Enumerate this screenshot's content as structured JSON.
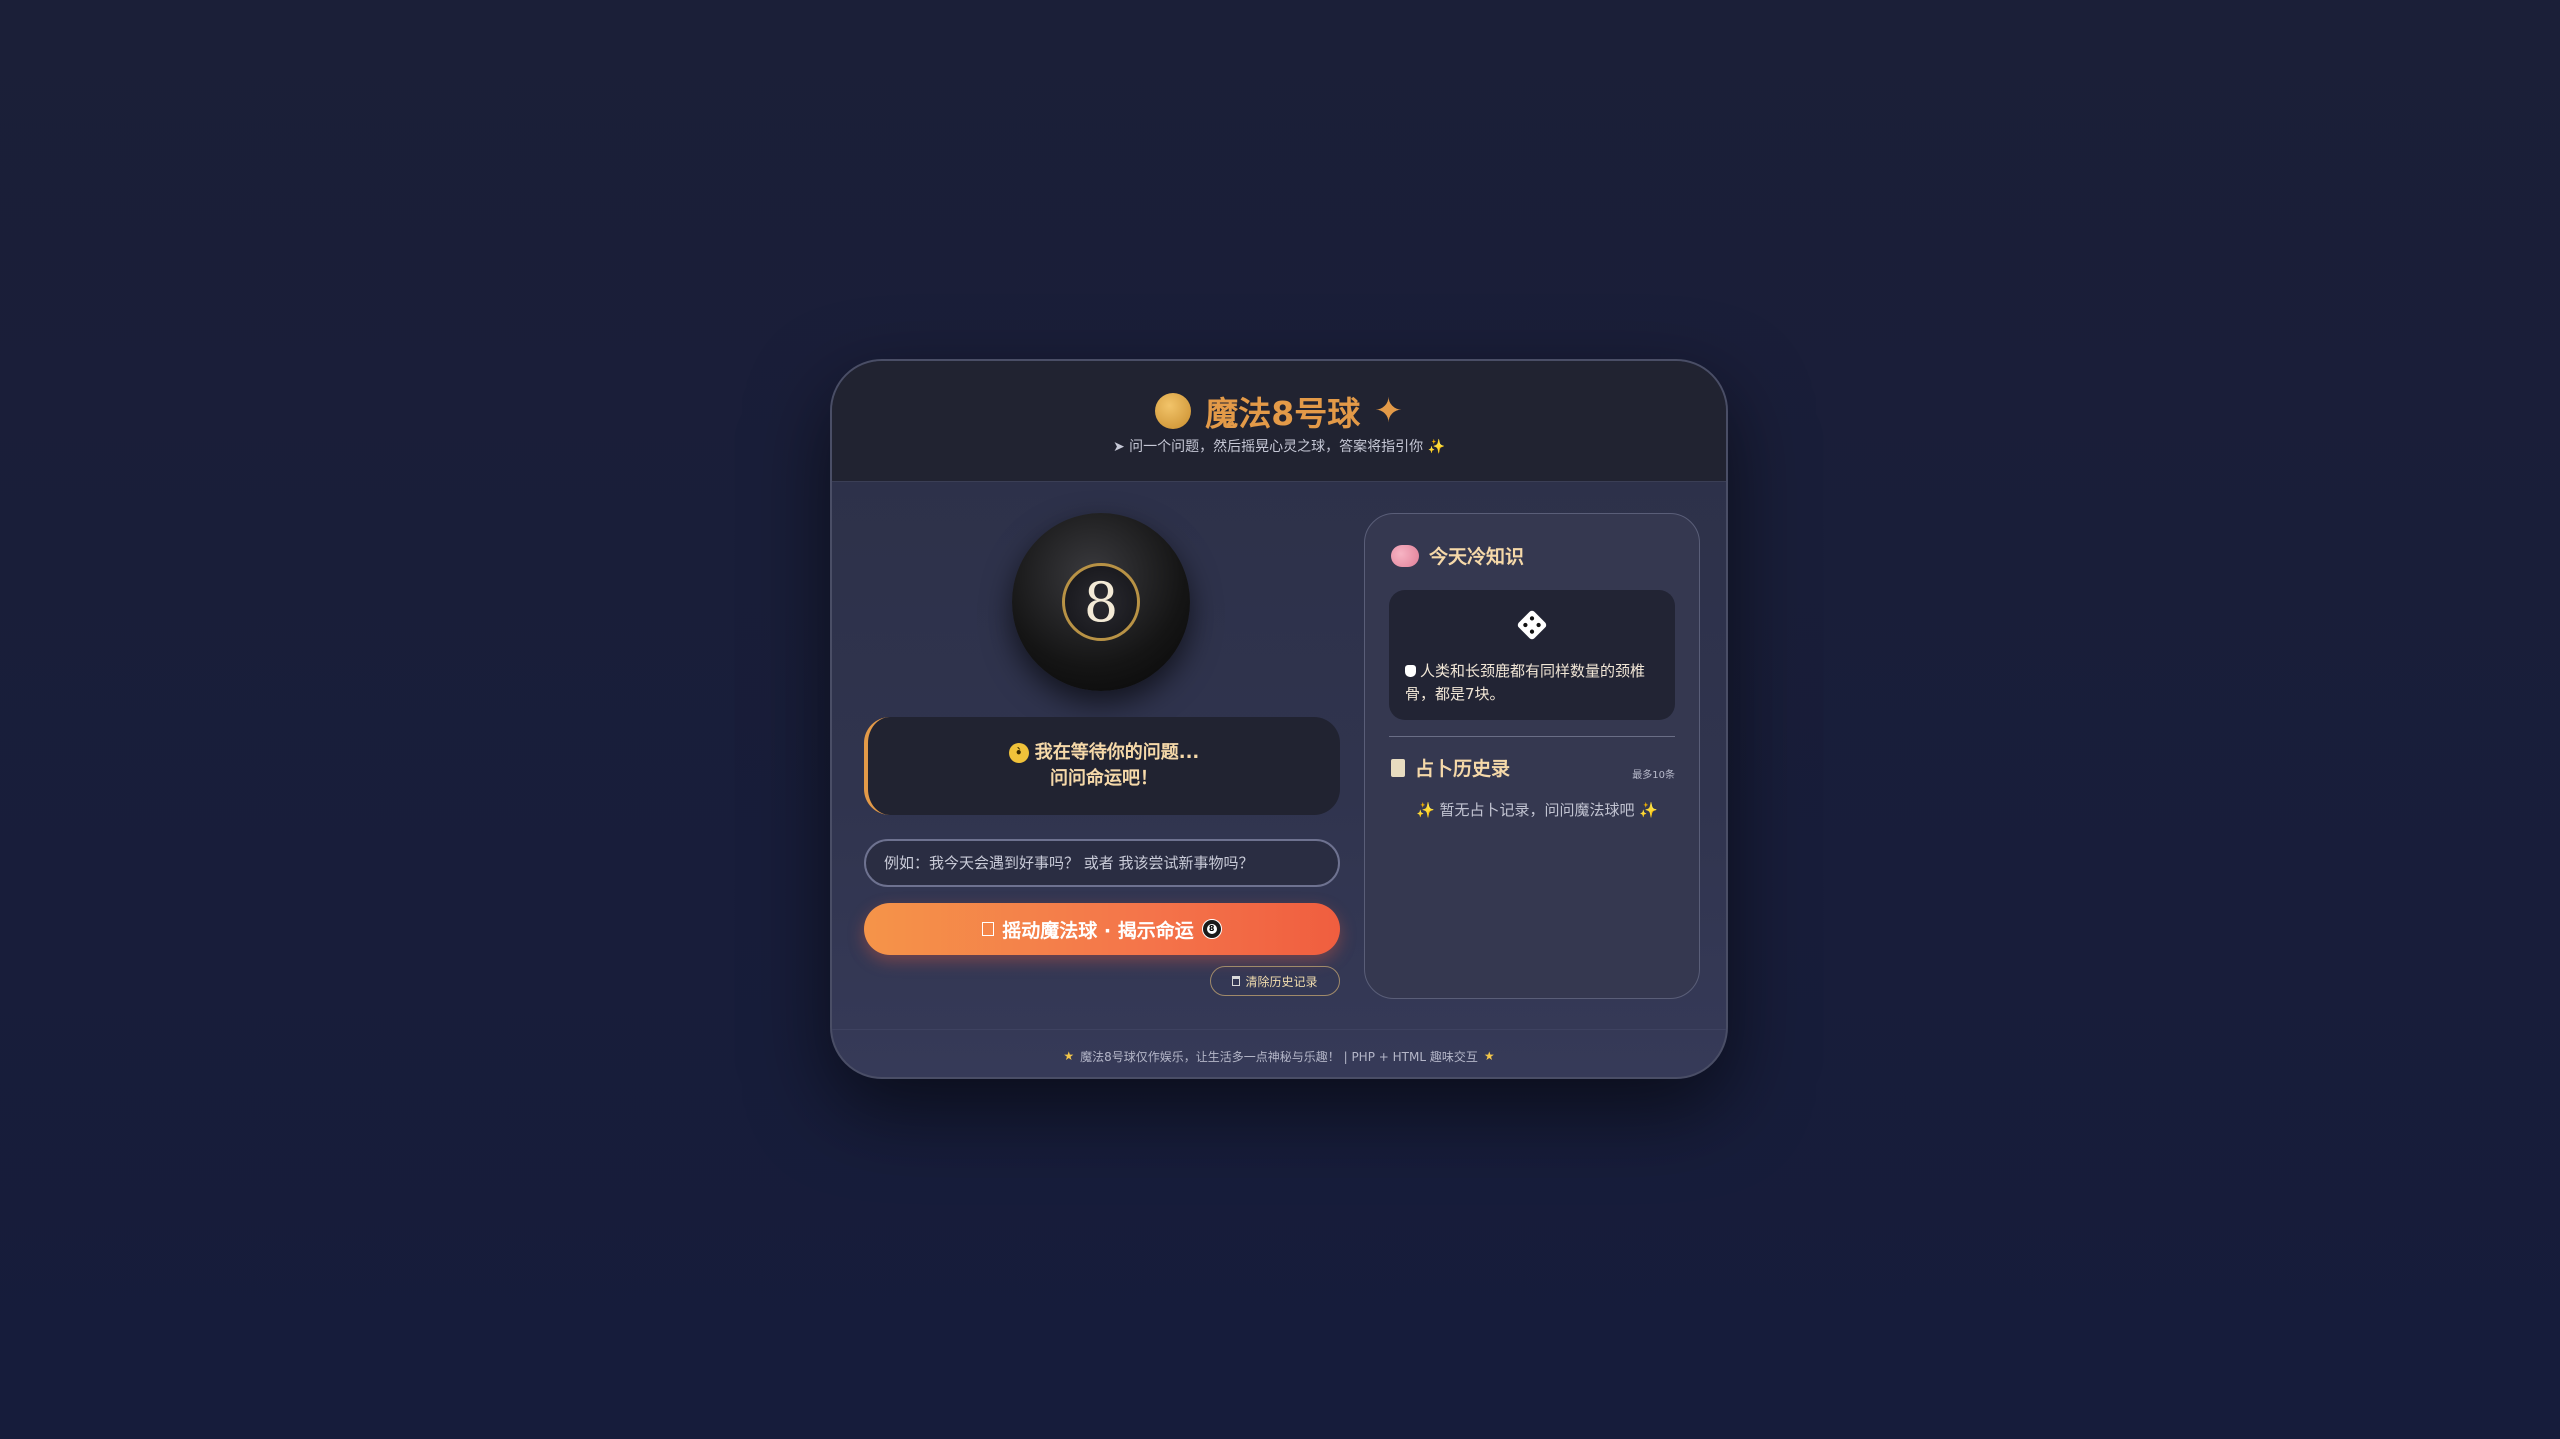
{
  "header": {
    "title": "魔法8号球",
    "subtitle": "问一个问题，然后摇晃心灵之球，答案将指引你"
  },
  "ball": {
    "number": "8"
  },
  "answer": {
    "line1": "我在等待你的问题...",
    "line2": "问问命运吧！"
  },
  "question_input": {
    "value": "",
    "placeholder": "例如：我今天会遇到好事吗？ 或者 我该尝试新事物吗？"
  },
  "shake_button": {
    "label": "摇动魔法球 · 揭示命运"
  },
  "clear_button": {
    "label": "清除历史记录"
  },
  "fact_panel": {
    "heading": "今天冷知识",
    "text": "人类和长颈鹿都有同样数量的颈椎骨，都是7块。"
  },
  "history_panel": {
    "heading": "占卜历史录",
    "limit_note": "最多10条",
    "empty_text": "暂无占卜记录，问问魔法球吧"
  },
  "footer": {
    "text": "魔法8号球仅作娱乐，让生活多一点神秘与乐趣！ | PHP + HTML 趣味交互"
  },
  "colors": {
    "accent": "#e39a48",
    "button_start": "#f59449",
    "button_end": "#f05e3f",
    "background": "#1b1f38"
  }
}
